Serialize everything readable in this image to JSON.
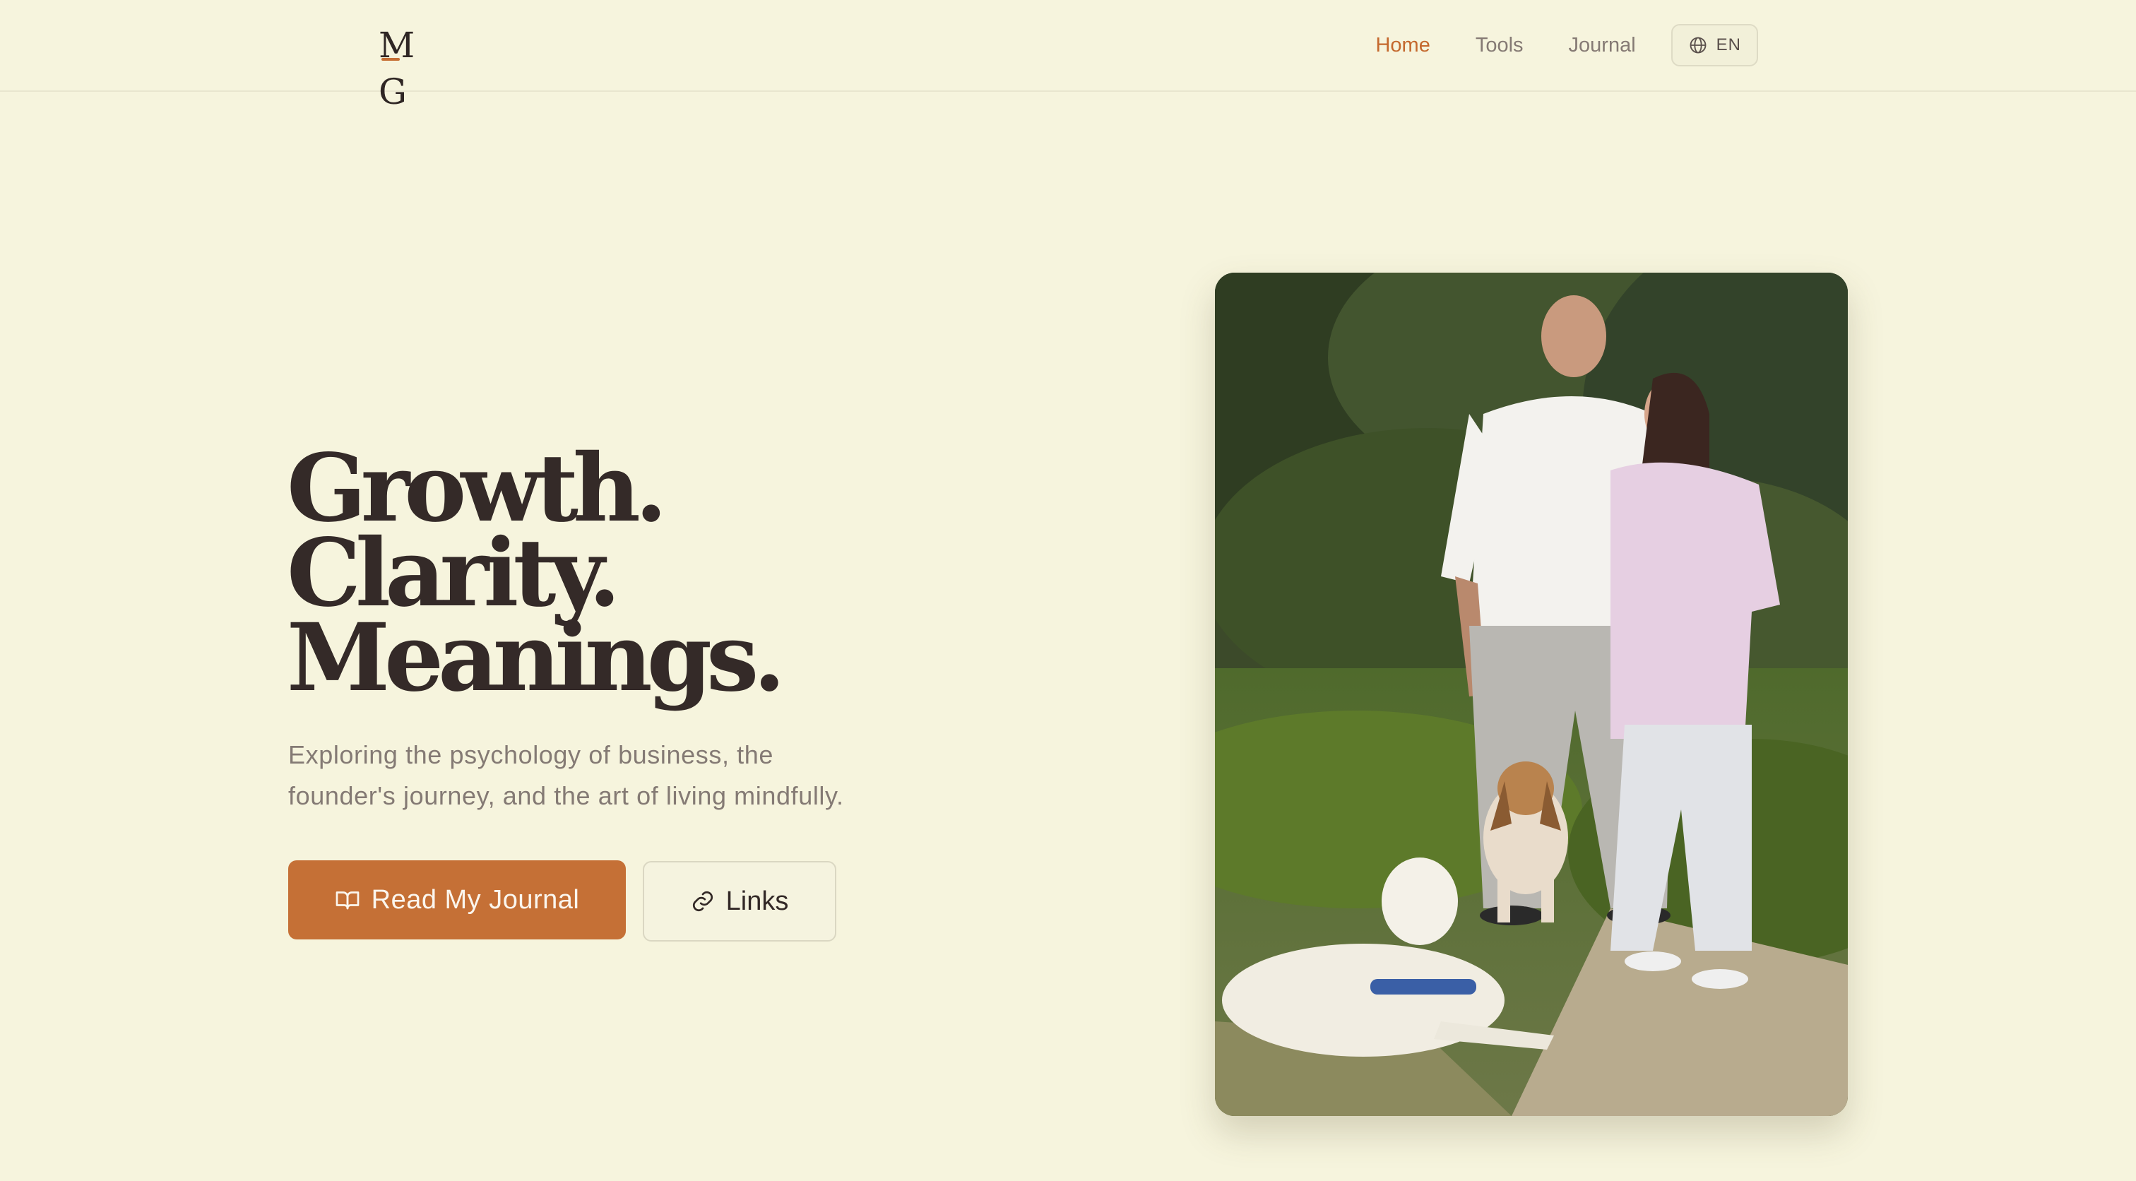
{
  "header": {
    "logo": {
      "m": "M",
      "g": "G"
    },
    "nav": [
      {
        "label": "Home",
        "active": true
      },
      {
        "label": "Tools",
        "active": false
      },
      {
        "label": "Journal",
        "active": false
      }
    ],
    "language": {
      "label": "EN",
      "icon": "globe-icon"
    }
  },
  "hero": {
    "title_lines": [
      "Growth.",
      "Clarity.",
      "Meanings."
    ],
    "subtitle_line1": "Exploring the psychology of business, the",
    "subtitle_line2": "founder's journey, and the art of living mindfully.",
    "primary_button": {
      "label": "Read My Journal",
      "icon": "book-open-icon"
    },
    "secondary_button": {
      "label": "Links",
      "icon": "link-icon"
    },
    "photo": {
      "subject": "couple-with-two-dogs-outdoors"
    }
  },
  "colors": {
    "background": "#f6f4dd",
    "accent": "#c57036",
    "text_dark": "#342a28",
    "text_muted": "#847a74"
  }
}
